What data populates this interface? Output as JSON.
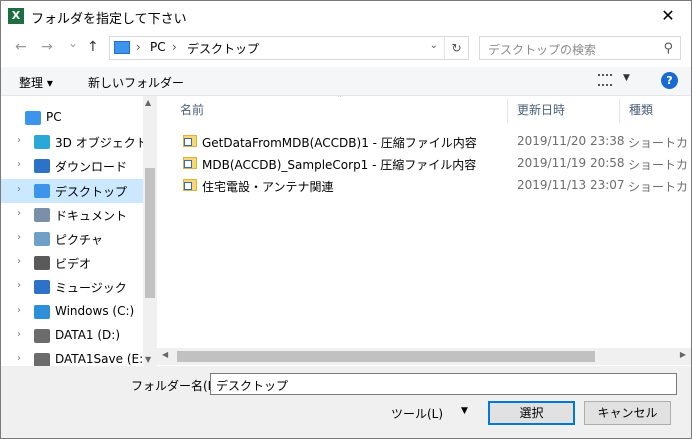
{
  "window": {
    "title": "フォルダを指定して下さい",
    "app_icon_letter": "X",
    "close_glyph": "✕"
  },
  "nav": {
    "back": "←",
    "forward": "→",
    "recent": "⌄",
    "up": "↑"
  },
  "address": {
    "separator": "›",
    "crumbs": [
      "PC",
      "デスクトップ"
    ],
    "dropdown": "⌄",
    "refresh": "↻"
  },
  "search": {
    "placeholder": "デスクトップの検索",
    "icon": "⚲"
  },
  "toolbar": {
    "organize": "整理 ▾",
    "new_folder": "新しいフォルダー",
    "view_dropdown": "▼",
    "help": "?"
  },
  "sidebar": {
    "items": [
      {
        "label": "PC",
        "icon": "pc-icon",
        "color": "#3c95ea"
      },
      {
        "label": "3D オブジェクト",
        "icon": "3d-objects-icon",
        "color": "#2aa8d8"
      },
      {
        "label": "ダウンロード",
        "icon": "download-icon",
        "color": "#2e72c7"
      },
      {
        "label": "デスクトップ",
        "icon": "desktop-icon",
        "color": "#3c95ea",
        "selected": true
      },
      {
        "label": "ドキュメント",
        "icon": "documents-icon",
        "color": "#7a8fa8"
      },
      {
        "label": "ピクチャ",
        "icon": "pictures-icon",
        "color": "#6ea0c8"
      },
      {
        "label": "ビデオ",
        "icon": "videos-icon",
        "color": "#5a5a5a"
      },
      {
        "label": "ミュージック",
        "icon": "music-icon",
        "color": "#2e72c7"
      },
      {
        "label": "Windows (C:)",
        "icon": "windows-drive-icon",
        "color": "#2e8fd8"
      },
      {
        "label": "DATA1 (D:)",
        "icon": "drive-icon",
        "color": "#6b6b6b"
      },
      {
        "label": "DATA1Save (E:",
        "icon": "drive-icon",
        "color": "#6b6b6b"
      }
    ],
    "chevron": "›"
  },
  "list": {
    "columns": [
      "名前",
      "更新日時",
      "種類"
    ],
    "sort_indicator": "˄",
    "rows": [
      {
        "name": "GetDataFromMDB(ACCDB)1 - 圧縮ファイル内容",
        "date": "2019/11/20 23:38",
        "type": "ショートカ"
      },
      {
        "name": "MDB(ACCDB)_SampleCorp1 - 圧縮ファイル内容",
        "date": "2019/11/19 20:58",
        "type": "ショートカ"
      },
      {
        "name": "住宅電設・アンテナ関連",
        "date": "2019/11/13 23:07",
        "type": "ショートカ"
      }
    ]
  },
  "footer": {
    "folder_name_label": "フォルダー名(N):",
    "folder_name_value": "デスクトップ",
    "tools_label": "ツール(L)",
    "tools_dropdown": "▼",
    "select_button": "選択",
    "cancel_button": "キャンセル"
  }
}
